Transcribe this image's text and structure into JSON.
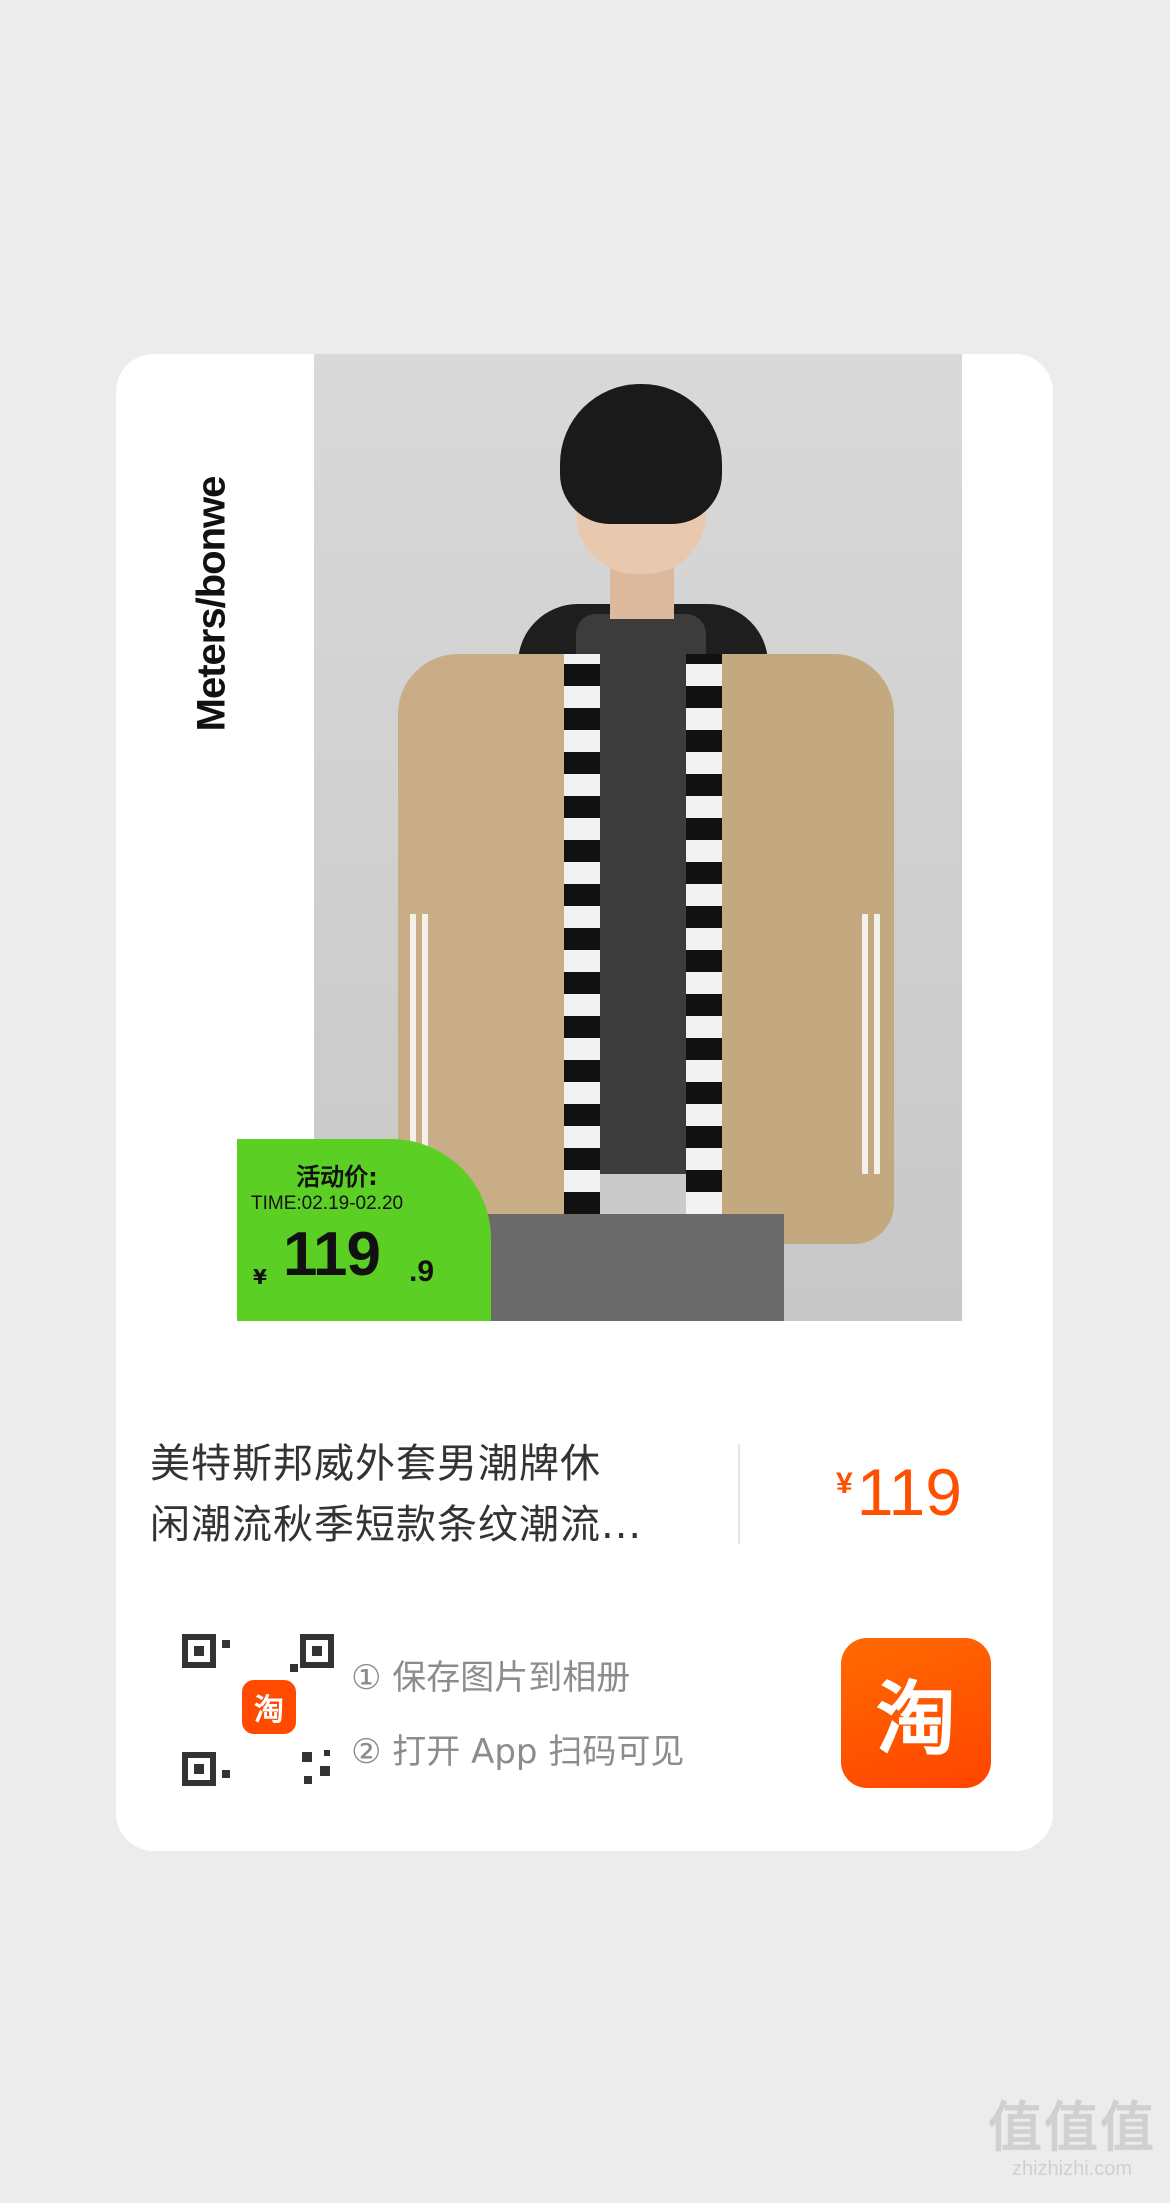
{
  "product": {
    "brand": "Meters/bonwe",
    "badge": {
      "title": "活动价:",
      "time": "TIME:02.19-02.20",
      "currency": "¥",
      "price_int": "119",
      "price_dec": ".9",
      "color": "#5ccf24"
    },
    "title_line1": "美特斯邦威外套男潮牌休",
    "title_line2": "闲潮流秋季短款条纹潮流...",
    "currency": "¥",
    "price": "119",
    "price_color": "#ff5000"
  },
  "share": {
    "qr_logo_icon": "淘",
    "step1": "① 保存图片到相册",
    "step2": "② 打开 App 扫码可见",
    "app_icon": "淘",
    "app_color": "#ff5000"
  },
  "watermark": {
    "mark": "值值值",
    "url": "zhizhizhi.com"
  }
}
